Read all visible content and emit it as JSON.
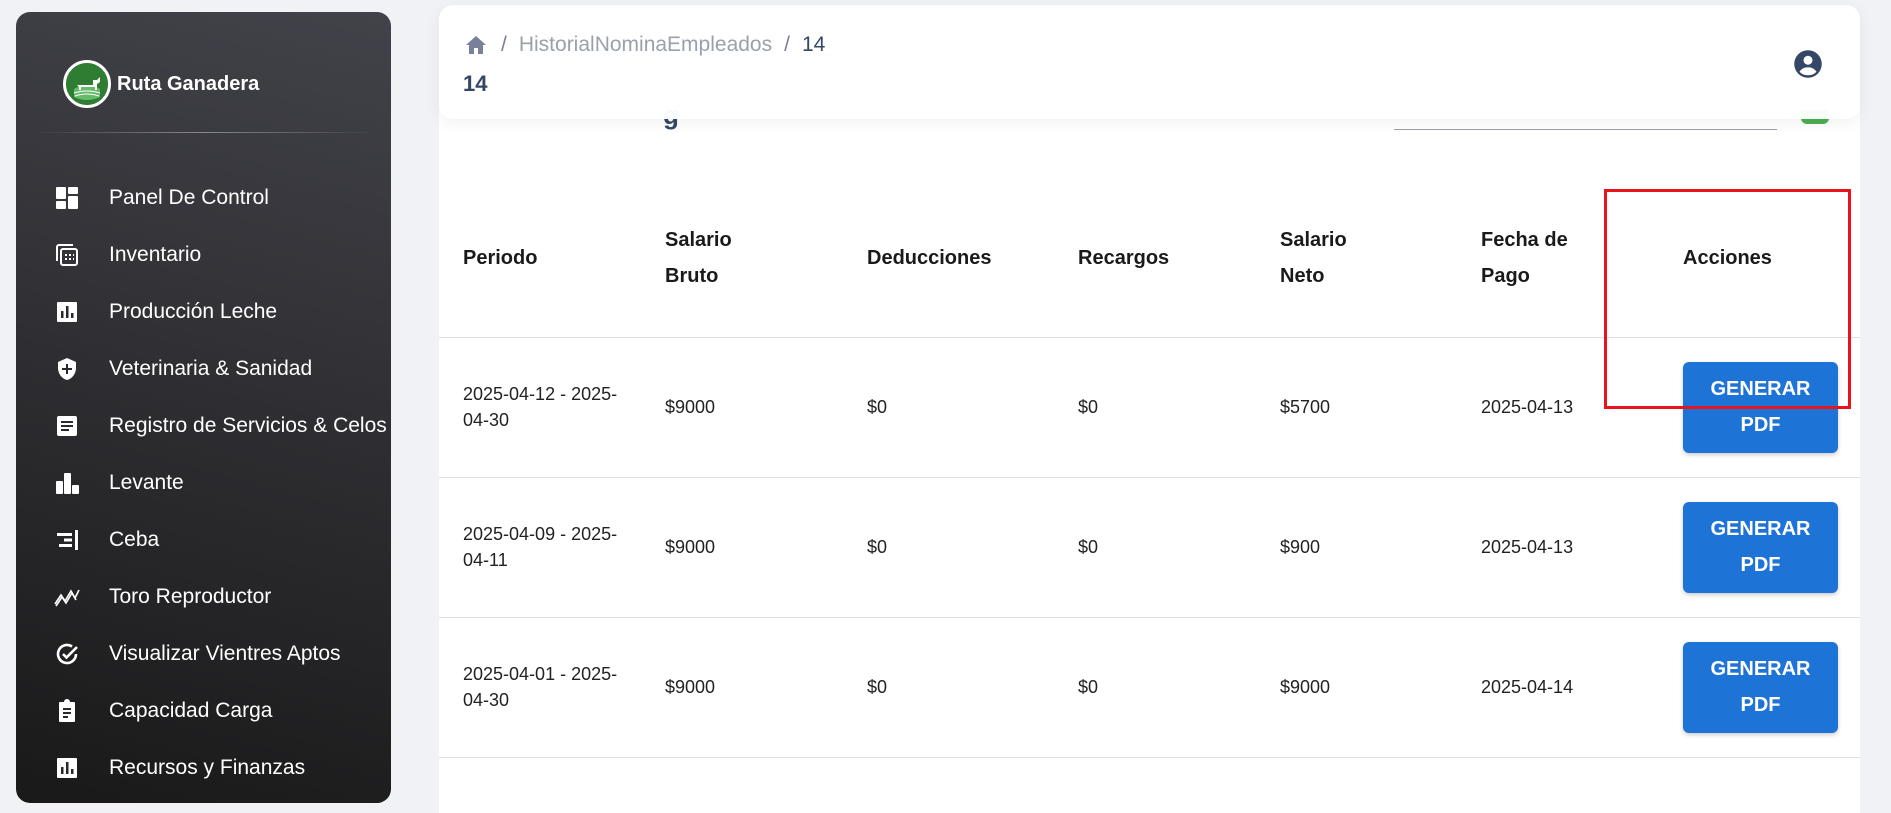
{
  "sidebar": {
    "brand_name": "Ruta Ganadera",
    "items": [
      {
        "label": "Panel De Control",
        "icon": "dashboard-icon"
      },
      {
        "label": "Inventario",
        "icon": "inventory-icon"
      },
      {
        "label": "Producción Leche",
        "icon": "bar-chart-icon"
      },
      {
        "label": "Veterinaria & Sanidad",
        "icon": "health-shield-icon"
      },
      {
        "label": "Registro de Servicios & Celos",
        "icon": "document-icon"
      },
      {
        "label": "Levante",
        "icon": "leaderboard-icon"
      },
      {
        "label": "Ceba",
        "icon": "align-right-icon"
      },
      {
        "label": "Toro Reproductor",
        "icon": "trend-line-icon"
      },
      {
        "label": "Visualizar Vientres Aptos",
        "icon": "check-circle-icon"
      },
      {
        "label": "Capacidad Carga",
        "icon": "clipboard-icon"
      },
      {
        "label": "Recursos y Finanzas",
        "icon": "finance-chart-icon"
      }
    ]
  },
  "header": {
    "breadcrumb": [
      "HistorialNominaEmpleados",
      "14"
    ],
    "title": "14"
  },
  "main": {
    "partial_title": "g",
    "table": {
      "columns": [
        "Periodo",
        "Salario Bruto",
        "Deducciones",
        "Recargos",
        "Salario Neto",
        "Fecha de Pago",
        "Acciones"
      ],
      "rows": [
        {
          "periodo": "2025-04-12 - 2025-04-30",
          "bruto": "$9000",
          "deducciones": "$0",
          "recargos": "$0",
          "neto": "$5700",
          "fecha": "2025-04-13",
          "action": "GENERAR PDF"
        },
        {
          "periodo": "2025-04-09 - 2025-04-11",
          "bruto": "$9000",
          "deducciones": "$0",
          "recargos": "$0",
          "neto": "$900",
          "fecha": "2025-04-13",
          "action": "GENERAR PDF"
        },
        {
          "periodo": "2025-04-01 - 2025-04-30",
          "bruto": "$9000",
          "deducciones": "$0",
          "recargos": "$0",
          "neto": "$9000",
          "fecha": "2025-04-14",
          "action": "GENERAR PDF"
        }
      ]
    }
  },
  "colors": {
    "sidebar_top": "#42424a",
    "sidebar_bottom": "#191919",
    "button": "#1e73d6",
    "highlight": "#e8141b"
  }
}
